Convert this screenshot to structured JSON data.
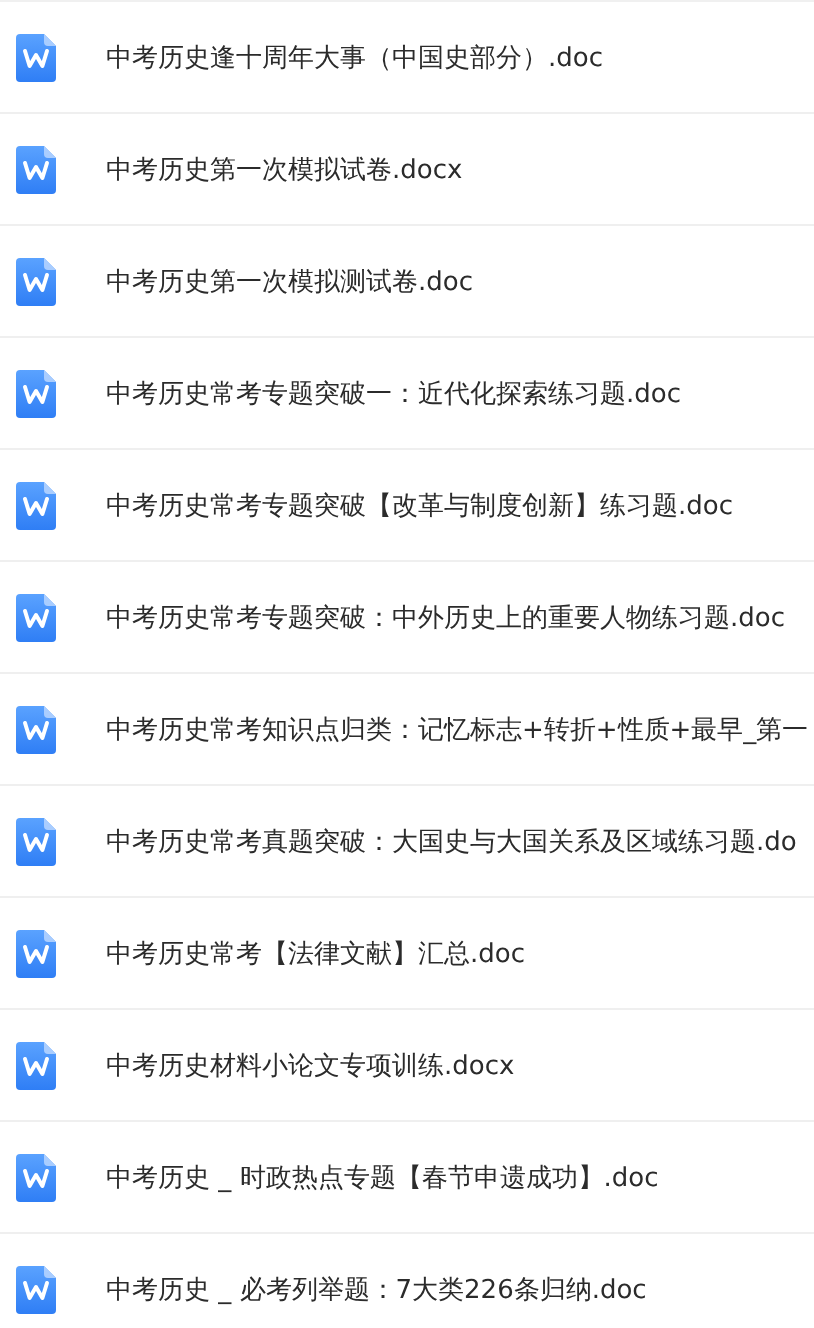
{
  "files": [
    {
      "name": "中考历史逢十周年大事（中国史部分）.doc"
    },
    {
      "name": "中考历史第一次模拟试卷.docx"
    },
    {
      "name": "中考历史第一次模拟测试卷.doc"
    },
    {
      "name": "中考历史常考专题突破一：近代化探索练习题.doc"
    },
    {
      "name": "中考历史常考专题突破【改革与制度创新】练习题.doc"
    },
    {
      "name": "中考历史常考专题突破：中外历史上的重要人物练习题.doc"
    },
    {
      "name": "中考历史常考知识点归类：记忆标志+转折+性质+最早_第一"
    },
    {
      "name": "中考历史常考真题突破：大国史与大国关系及区域练习题.do"
    },
    {
      "name": "中考历史常考【法律文献】汇总.doc"
    },
    {
      "name": "中考历史材料小论文专项训练.docx"
    },
    {
      "name": "中考历史 _ 时政热点专题【春节申遗成功】.doc"
    },
    {
      "name": "中考历史 _ 必考列举题：7大类226条归纳.doc"
    }
  ]
}
